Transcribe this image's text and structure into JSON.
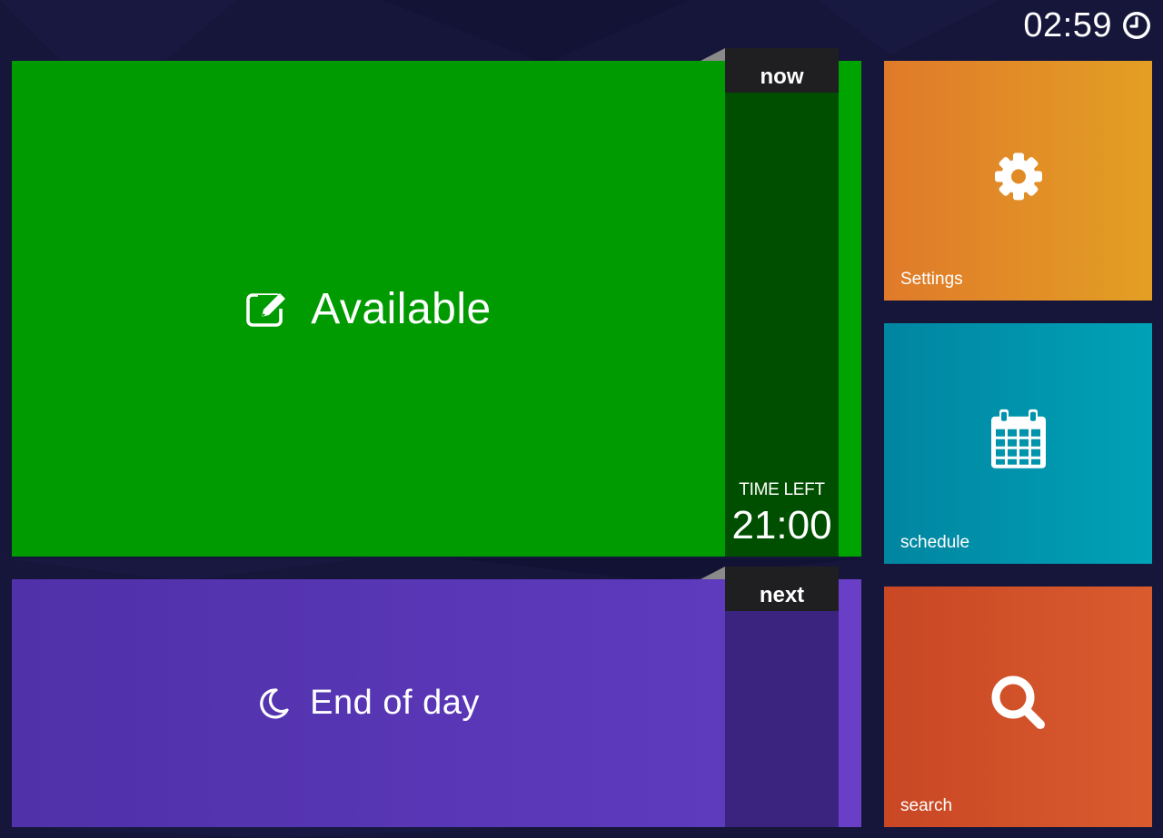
{
  "clock": {
    "time": "02:59",
    "icon": "clock-icon"
  },
  "now": {
    "tab": "now",
    "status": "Available",
    "icon": "edit-icon",
    "color": "#009b00",
    "time_left_label": "TIME LEFT",
    "time_left": "21:00"
  },
  "next": {
    "tab": "next",
    "status": "End of day",
    "icon": "moon-icon",
    "color": "#5a38b8"
  },
  "nav": {
    "settings": {
      "label": "Settings",
      "icon": "gear-icon",
      "color": "#e28a27"
    },
    "schedule": {
      "label": "schedule",
      "icon": "calendar-icon",
      "color": "#0094ac"
    },
    "search": {
      "label": "search",
      "icon": "search-icon",
      "color": "#d2502a"
    }
  }
}
